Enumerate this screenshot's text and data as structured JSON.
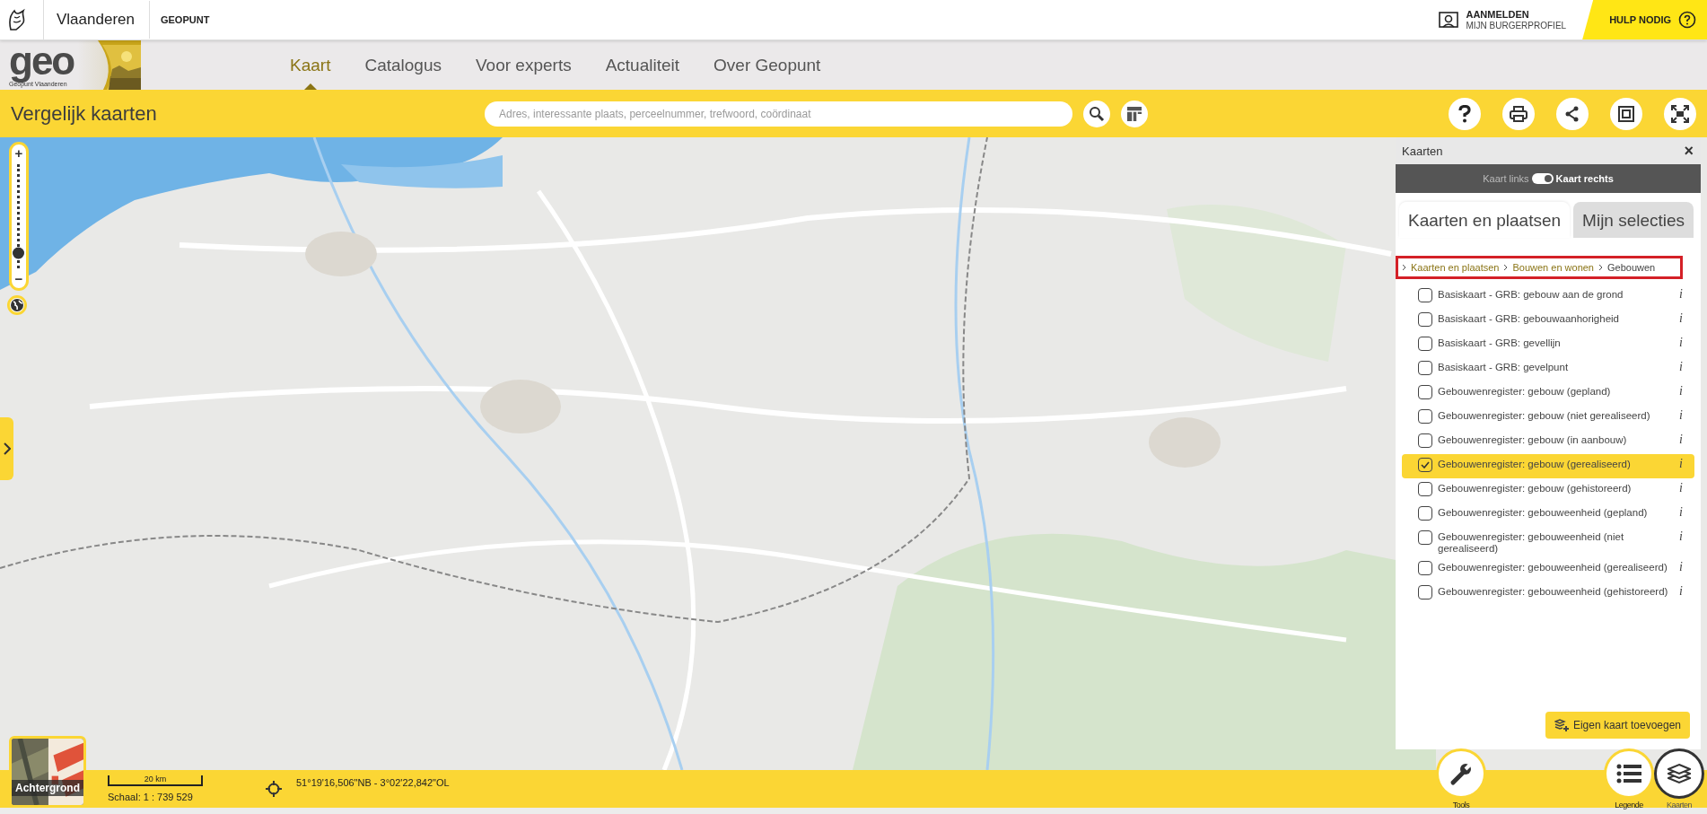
{
  "header": {
    "region": "Vlaanderen",
    "site": "GEOPUNT",
    "login": {
      "title": "AANMELDEN",
      "subtitle": "MIJN BURGERPROFIEL"
    },
    "help": "HULP NODIG"
  },
  "nav": {
    "logo": "geo",
    "logo_caption": "Geopunt Vlaanderen",
    "items": [
      {
        "label": "Kaart",
        "selected": true
      },
      {
        "label": "Catalogus",
        "selected": false
      },
      {
        "label": "Voor experts",
        "selected": false
      },
      {
        "label": "Actualiteit",
        "selected": false
      },
      {
        "label": "Over Geopunt",
        "selected": false
      }
    ]
  },
  "toolbar": {
    "title": "Vergelijk kaarten",
    "search": {
      "placeholder": "Adres, interessante plaats, perceelnummer, trefwoord, coördinaat"
    }
  },
  "map": {
    "zoom": {
      "plus": "+",
      "minus": "−",
      "level": 0.15
    }
  },
  "panel": {
    "title": "Kaarten",
    "close": "×",
    "compare": {
      "left": "Kaart links",
      "right": "Kaart rechts",
      "on": true
    },
    "tabs": [
      {
        "label": "Kaarten en plaatsen",
        "selected": true
      },
      {
        "label": "Mijn selecties",
        "selected": false
      }
    ],
    "breadcrumb": [
      {
        "label": "Kaarten en plaatsen",
        "kind": "link"
      },
      {
        "label": "Bouwen en wonen",
        "kind": "link"
      },
      {
        "label": "Gebouwen",
        "kind": "current"
      }
    ],
    "layers": [
      {
        "label": "Basiskaart - GRB: gebouw aan de grond",
        "checked": false,
        "info": "i"
      },
      {
        "label": "Basiskaart - GRB: gebouwaanhorigheid",
        "checked": false,
        "info": "i"
      },
      {
        "label": "Basiskaart - GRB: gevellijn",
        "checked": false,
        "info": "i"
      },
      {
        "label": "Basiskaart - GRB: gevelpunt",
        "checked": false,
        "info": "i"
      },
      {
        "label": "Gebouwenregister: gebouw (gepland)",
        "checked": false,
        "info": "i"
      },
      {
        "label": "Gebouwenregister: gebouw (niet gerealiseerd)",
        "checked": false,
        "info": "i"
      },
      {
        "label": "Gebouwenregister: gebouw (in aanbouw)",
        "checked": false,
        "info": "i"
      },
      {
        "label": "Gebouwenregister: gebouw (gerealiseerd)",
        "checked": true,
        "info": "i"
      },
      {
        "label": "Gebouwenregister: gebouw (gehistoreerd)",
        "checked": false,
        "info": "i"
      },
      {
        "label": "Gebouwenregister: gebouweenheid (gepland)",
        "checked": false,
        "info": "i"
      },
      {
        "label": "Gebouwenregister: gebouweenheid (niet gerealiseerd)",
        "checked": false,
        "info": "i"
      },
      {
        "label": "Gebouwenregister: gebouweenheid (gerealiseerd)",
        "checked": false,
        "info": "i"
      },
      {
        "label": "Gebouwenregister: gebouweenheid (gehistoreerd)",
        "checked": false,
        "info": "i"
      }
    ],
    "add_button": "Eigen kaart toevoegen"
  },
  "footer": {
    "background": "Achtergrond",
    "scale_bar": "20 km",
    "scale": "Schaal: 1 : 739 529",
    "coordinates": "51°19'16,506\"NB - 3°02'22,842\"OL",
    "buttons": [
      {
        "label": "Tools",
        "kind": "tools",
        "selected": false
      },
      {
        "label": "Legende",
        "kind": "legend",
        "selected": false
      },
      {
        "label": "Kaarten",
        "kind": "layers",
        "selected": true
      }
    ]
  }
}
